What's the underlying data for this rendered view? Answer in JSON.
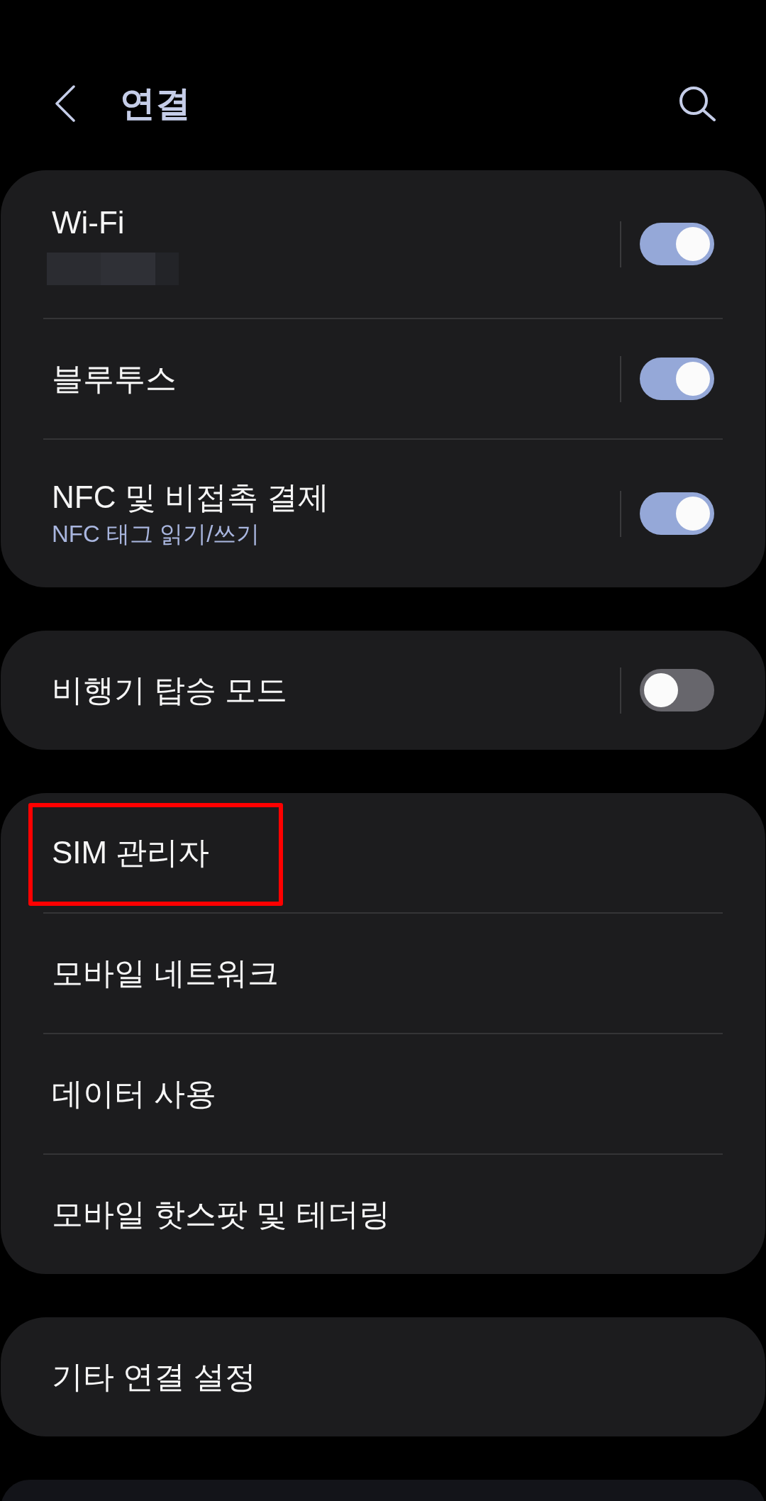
{
  "header": {
    "title": "연결"
  },
  "groups": [
    {
      "items": [
        {
          "kind": "toggle",
          "label": "Wi-Fi",
          "redacted_subtitle": true,
          "on": true,
          "highlighted": false
        },
        {
          "kind": "toggle",
          "label": "블루투스",
          "redacted_subtitle": false,
          "on": true,
          "highlighted": false
        },
        {
          "kind": "toggle",
          "label": "NFC 및 비접촉 결제",
          "subtitle": "NFC 태그 읽기/쓰기",
          "redacted_subtitle": false,
          "on": true,
          "highlighted": false
        }
      ]
    },
    {
      "items": [
        {
          "kind": "toggle",
          "label": "비행기 탑승 모드",
          "on": false,
          "highlighted": false
        }
      ]
    },
    {
      "items": [
        {
          "kind": "link",
          "label": "SIM 관리자",
          "highlighted": true
        },
        {
          "kind": "link",
          "label": "모바일 네트워크",
          "highlighted": false
        },
        {
          "kind": "link",
          "label": "데이터 사용",
          "highlighted": false
        },
        {
          "kind": "link",
          "label": "모바일 핫스팟 및 테더링",
          "highlighted": false
        }
      ]
    },
    {
      "items": [
        {
          "kind": "link",
          "label": "기타 연결 설정",
          "highlighted": false
        }
      ]
    }
  ],
  "next_card_partly_visible": true
}
